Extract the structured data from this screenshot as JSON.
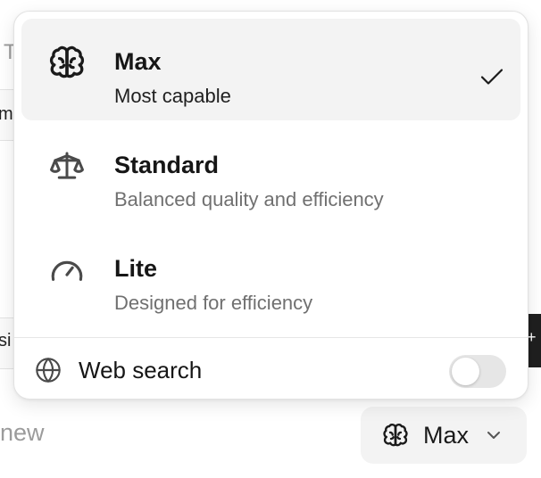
{
  "background": {
    "fragment_t": "T",
    "fragment_mp": "mp",
    "fragment_si": "si",
    "fragment_plus": "+",
    "composer_placeholder_tail": "new"
  },
  "model_button": {
    "label": "Max",
    "icon": "brain-icon",
    "chevron_icon": "chevron-down-icon"
  },
  "menu": {
    "options": [
      {
        "title": "Max",
        "subtitle": "Most capable",
        "icon": "brain-icon",
        "selected": true
      },
      {
        "title": "Standard",
        "subtitle": "Balanced quality and efficiency",
        "icon": "scale-icon",
        "selected": false
      },
      {
        "title": "Lite",
        "subtitle": "Designed for efficiency",
        "icon": "speedometer-icon",
        "selected": false
      }
    ],
    "web_search": {
      "label": "Web search",
      "icon": "globe-icon",
      "enabled": false
    }
  },
  "colors": {
    "selected_bg": "#f3f3f3",
    "text_primary": "#161616",
    "text_secondary": "#707070",
    "toggle_off": "#e6e6e6"
  }
}
